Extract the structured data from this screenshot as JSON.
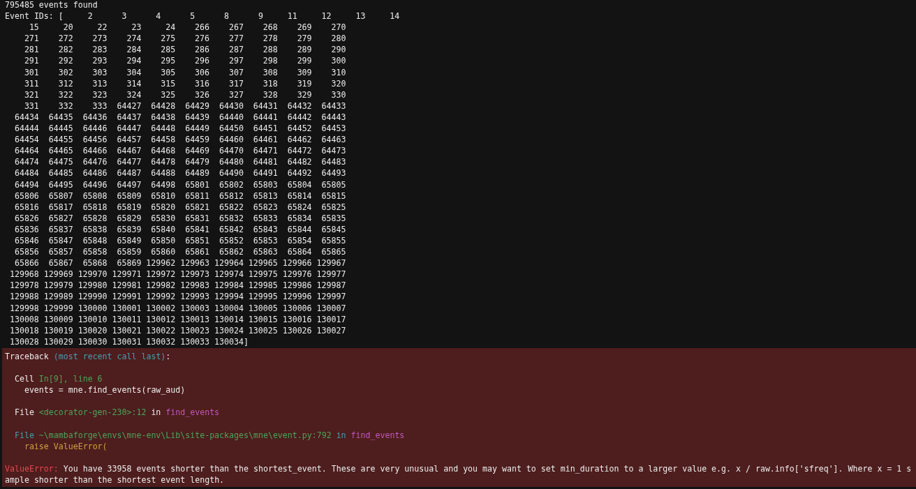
{
  "output": {
    "summary": "795485 events found",
    "event_ids": {
      "label": "Event IDs:",
      "open": "[",
      "first_values": [
        "2",
        "3",
        "4",
        "5",
        "8",
        "9",
        "11",
        "12",
        "13",
        "14"
      ],
      "close": "]",
      "rows": [
        [
          "15",
          "20",
          "22",
          "23",
          "24",
          "266",
          "267",
          "268",
          "269",
          "270"
        ],
        [
          "271",
          "272",
          "273",
          "274",
          "275",
          "276",
          "277",
          "278",
          "279",
          "280"
        ],
        [
          "281",
          "282",
          "283",
          "284",
          "285",
          "286",
          "287",
          "288",
          "289",
          "290"
        ],
        [
          "291",
          "292",
          "293",
          "294",
          "295",
          "296",
          "297",
          "298",
          "299",
          "300"
        ],
        [
          "301",
          "302",
          "303",
          "304",
          "305",
          "306",
          "307",
          "308",
          "309",
          "310"
        ],
        [
          "311",
          "312",
          "313",
          "314",
          "315",
          "316",
          "317",
          "318",
          "319",
          "320"
        ],
        [
          "321",
          "322",
          "323",
          "324",
          "325",
          "326",
          "327",
          "328",
          "329",
          "330"
        ],
        [
          "331",
          "332",
          "333",
          "64427",
          "64428",
          "64429",
          "64430",
          "64431",
          "64432",
          "64433"
        ],
        [
          "64434",
          "64435",
          "64436",
          "64437",
          "64438",
          "64439",
          "64440",
          "64441",
          "64442",
          "64443"
        ],
        [
          "64444",
          "64445",
          "64446",
          "64447",
          "64448",
          "64449",
          "64450",
          "64451",
          "64452",
          "64453"
        ],
        [
          "64454",
          "64455",
          "64456",
          "64457",
          "64458",
          "64459",
          "64460",
          "64461",
          "64462",
          "64463"
        ],
        [
          "64464",
          "64465",
          "64466",
          "64467",
          "64468",
          "64469",
          "64470",
          "64471",
          "64472",
          "64473"
        ],
        [
          "64474",
          "64475",
          "64476",
          "64477",
          "64478",
          "64479",
          "64480",
          "64481",
          "64482",
          "64483"
        ],
        [
          "64484",
          "64485",
          "64486",
          "64487",
          "64488",
          "64489",
          "64490",
          "64491",
          "64492",
          "64493"
        ],
        [
          "64494",
          "64495",
          "64496",
          "64497",
          "64498",
          "65801",
          "65802",
          "65803",
          "65804",
          "65805"
        ],
        [
          "65806",
          "65807",
          "65808",
          "65809",
          "65810",
          "65811",
          "65812",
          "65813",
          "65814",
          "65815"
        ],
        [
          "65816",
          "65817",
          "65818",
          "65819",
          "65820",
          "65821",
          "65822",
          "65823",
          "65824",
          "65825"
        ],
        [
          "65826",
          "65827",
          "65828",
          "65829",
          "65830",
          "65831",
          "65832",
          "65833",
          "65834",
          "65835"
        ],
        [
          "65836",
          "65837",
          "65838",
          "65839",
          "65840",
          "65841",
          "65842",
          "65843",
          "65844",
          "65845"
        ],
        [
          "65846",
          "65847",
          "65848",
          "65849",
          "65850",
          "65851",
          "65852",
          "65853",
          "65854",
          "65855"
        ],
        [
          "65856",
          "65857",
          "65858",
          "65859",
          "65860",
          "65861",
          "65862",
          "65863",
          "65864",
          "65865"
        ],
        [
          "65866",
          "65867",
          "65868",
          "65869",
          "129962",
          "129963",
          "129964",
          "129965",
          "129966",
          "129967"
        ],
        [
          "129968",
          "129969",
          "129970",
          "129971",
          "129972",
          "129973",
          "129974",
          "129975",
          "129976",
          "129977"
        ],
        [
          "129978",
          "129979",
          "129980",
          "129981",
          "129982",
          "129983",
          "129984",
          "129985",
          "129986",
          "129987"
        ],
        [
          "129988",
          "129989",
          "129990",
          "129991",
          "129992",
          "129993",
          "129994",
          "129995",
          "129996",
          "129997"
        ],
        [
          "129998",
          "129999",
          "130000",
          "130001",
          "130002",
          "130003",
          "130004",
          "130005",
          "130006",
          "130007"
        ],
        [
          "130008",
          "130009",
          "130010",
          "130011",
          "130012",
          "130013",
          "130014",
          "130015",
          "130016",
          "130017"
        ],
        [
          "130018",
          "130019",
          "130020",
          "130021",
          "130022",
          "130023",
          "130024",
          "130025",
          "130026",
          "130027"
        ],
        [
          "130028",
          "130029",
          "130030",
          "130031",
          "130032",
          "130033",
          "130034"
        ]
      ]
    }
  },
  "traceback": {
    "title": "Traceback",
    "note": "(most recent call last)",
    "colon": ":",
    "frames": [
      {
        "label": "Cell",
        "location": "In[9], line 6",
        "code": "events = mne.find_events(raw_aud)",
        "highlighted": false
      },
      {
        "label": "File",
        "location": "<decorator-gen-230>:12",
        "in": "in",
        "function": "find_events",
        "highlighted": false
      },
      {
        "label": "File",
        "location": "~\\mambaforge\\envs\\mne-env\\Lib\\site-packages\\mne\\event.py:792",
        "in": "in",
        "function": "find_events",
        "code": "raise ValueError(",
        "highlighted": true
      }
    ],
    "error": {
      "type": "ValueError:",
      "message": "You have 33958 events shorter than the shortest_event. These are very unusual and you may want to set min_duration to a larger value e.g. x / raw.info['sfreq']. Where x = 1 sample shorter than the shortest event length."
    }
  }
}
